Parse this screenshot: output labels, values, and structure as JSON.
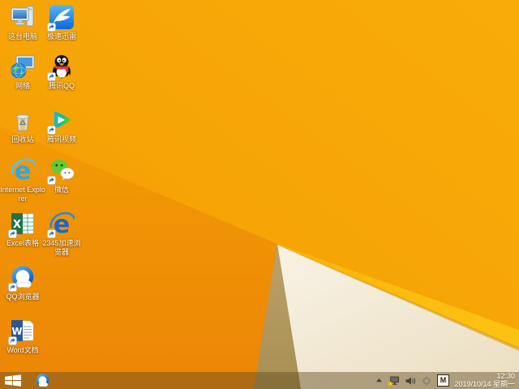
{
  "colors": {
    "wallpaper_orange_top": "#F8A907",
    "wallpaper_orange_deep": "#EE8B05",
    "fold_tan": "#B0965C",
    "fold_cream": "#F4EDDC",
    "fold_yellow_edge": "#FCBB10",
    "taskbar_tint": "#8A7342",
    "ie_blue": "#2DA8E8",
    "wechat_green": "#5ECC33",
    "excel_green": "#217346",
    "word_blue": "#2B579A",
    "qq_scarf_red": "#E23A2F",
    "xunlei_blue": "#1E87E6",
    "tencent_video_teal": "#0FB6F0",
    "tray_warning_yellow": "#F2C500"
  },
  "desktop": {
    "icons": [
      {
        "id": "this-pc",
        "label": "这台电脑",
        "shortcut": false
      },
      {
        "id": "xunlei",
        "label": "极速迅雷",
        "shortcut": true
      },
      {
        "id": "network",
        "label": "网络",
        "shortcut": false
      },
      {
        "id": "tencent-qq",
        "label": "腾讯QQ",
        "shortcut": true
      },
      {
        "id": "recycle-bin",
        "label": "回收站",
        "shortcut": false
      },
      {
        "id": "tencent-video",
        "label": "腾讯视频",
        "shortcut": true
      },
      {
        "id": "internet-explorer",
        "label": "Internet Explorer",
        "shortcut": false
      },
      {
        "id": "wechat",
        "label": "微信",
        "shortcut": true
      },
      {
        "id": "excel",
        "label": "Excel表格",
        "shortcut": true
      },
      {
        "id": "browser-2345",
        "label": "2345加速浏览器",
        "shortcut": true
      },
      {
        "id": "qq-browser",
        "label": "QQ浏览器",
        "shortcut": true
      },
      {
        "id": "word",
        "label": "Word文档",
        "shortcut": true
      }
    ]
  },
  "taskbar": {
    "start": {
      "icon": "windows-logo"
    },
    "pinned": [
      {
        "id": "qq-browser",
        "icon": "qq-browser"
      }
    ],
    "tray": {
      "icons": [
        {
          "name": "hidden-icons-chevron"
        },
        {
          "name": "network-warning"
        },
        {
          "name": "volume"
        },
        {
          "name": "crosshair-utility"
        },
        {
          "name": "ime-indicator",
          "label": "M"
        }
      ],
      "clock": {
        "time": "12:30",
        "date": "2019/10/14 星期一"
      }
    }
  }
}
